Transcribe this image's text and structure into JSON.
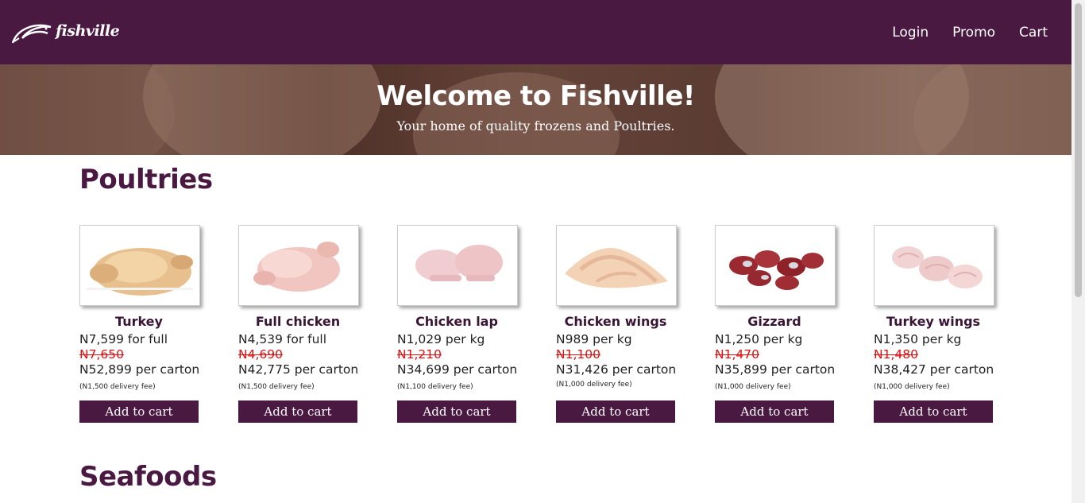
{
  "header": {
    "logo_text": "fishville",
    "nav": [
      "Login",
      "Promo",
      "Cart"
    ],
    "bg_color": "#4a1942"
  },
  "hero": {
    "title": "Welcome to Fishville!",
    "subtitle": "Your home of quality frozens and Poultries."
  },
  "sections": {
    "poultries": "Poultries",
    "seafoods": "Seafoods"
  },
  "products": [
    {
      "name": "Turkey",
      "price": "N7,599 for full",
      "old_price": "N7,650",
      "carton": "N52,899 per carton",
      "fee": "(N1,500 delivery fee)",
      "button": "Add to cart",
      "icon": "turkey-image"
    },
    {
      "name": "Full chicken",
      "price": "N4,539 for full",
      "old_price": "N4,690",
      "carton": "N42,775 per carton",
      "fee": "(N1,500 delivery fee)",
      "button": "Add to cart",
      "icon": "full-chicken-image"
    },
    {
      "name": "Chicken lap",
      "price": "N1,029 per kg",
      "old_price": "N1,210",
      "carton": "N34,699 per carton",
      "fee": "(N1,100 delivery fee)",
      "button": "Add to cart",
      "icon": "chicken-lap-image"
    },
    {
      "name": "Chicken wings",
      "price": "N989 per kg",
      "old_price": "N1,100",
      "carton": "N31,426 per carton",
      "fee": "(N1,000 delivery fee)",
      "button": "Add to cart",
      "icon": "chicken-wings-image"
    },
    {
      "name": "Gizzard",
      "price": "N1,250 per kg",
      "old_price": "N1,470",
      "carton": "N35,899 per carton",
      "fee": "(N1,000 delivery fee)",
      "button": "Add to cart",
      "icon": "gizzard-image"
    },
    {
      "name": "Turkey wings",
      "price": "N1,350 per kg",
      "old_price": "N1,480",
      "carton": "N38,427 per carton",
      "fee": "(N1,000 delivery fee)",
      "button": "Add to cart",
      "icon": "turkey-wings-image"
    }
  ],
  "colors": {
    "brand": "#4a1942",
    "old_price": "#e01010"
  }
}
